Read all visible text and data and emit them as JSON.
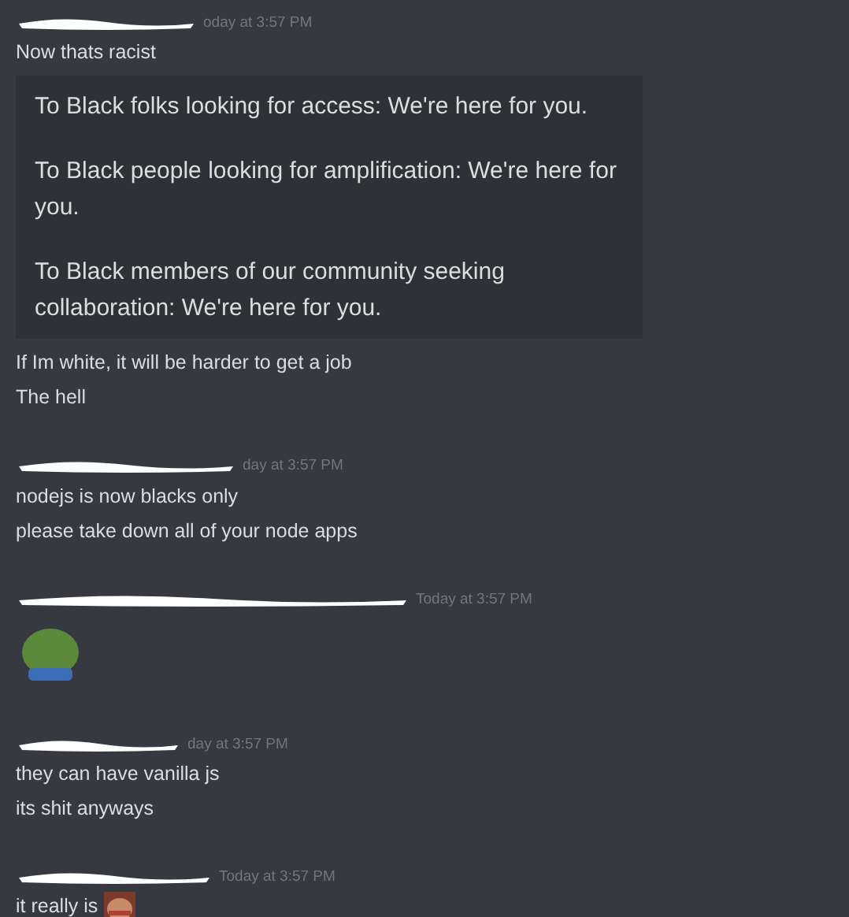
{
  "messages": [
    {
      "timestamp": "oday at 3:57 PM",
      "content": [
        {
          "kind": "text",
          "text": "Now thats racist"
        },
        {
          "kind": "quote",
          "paragraphs": [
            "To Black folks looking for access: We're here for you.",
            "To Black people looking for amplification: We're here for you.",
            "To Black members of our community seeking collaboration: We're here for you."
          ]
        },
        {
          "kind": "text",
          "text": "If Im white, it will be harder to get a job"
        },
        {
          "kind": "text",
          "text": "The hell"
        }
      ]
    },
    {
      "timestamp": "day at 3:57 PM",
      "content": [
        {
          "kind": "text",
          "text": "nodejs is now blacks only"
        },
        {
          "kind": "text",
          "text": "please take down all of your node apps"
        }
      ]
    },
    {
      "timestamp": "Today at 3:57 PM",
      "content": [
        {
          "kind": "emoji"
        }
      ]
    },
    {
      "timestamp": "day at 3:57 PM",
      "content": [
        {
          "kind": "text",
          "text": "they can have vanilla js"
        },
        {
          "kind": "text",
          "text": "its shit anyways"
        }
      ]
    },
    {
      "timestamp": "Today at 3:57 PM",
      "content": [
        {
          "kind": "text_picture",
          "text": "it really is"
        }
      ]
    }
  ]
}
